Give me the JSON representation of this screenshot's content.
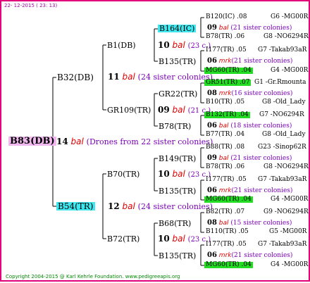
{
  "header": {
    "date": "22- 12-2015 ( 23: 13)"
  },
  "footer": {
    "copyright": "Copyright 2004-2015 @ Karl Kehrle Foundation.",
    "site": "www.pedigreeapis.org"
  },
  "root": {
    "id": "B83(DB)",
    "gen": "14",
    "mark": "bal",
    "note": "(Drones from 22 sister colonies)"
  },
  "g1": [
    {
      "id": "B32(DB)",
      "gen": "11",
      "mark": "bal",
      "note": "(24 sister colonies)"
    },
    {
      "id": "B54(TR)",
      "gen": "12",
      "mark": "bal",
      "note": "(24 sister colonies)"
    }
  ],
  "g2": [
    {
      "id": "B1(DB)",
      "gen": "10",
      "mark": "bal",
      "note": "(23 c.)"
    },
    {
      "id": "GR109(TR)",
      "gen": "09",
      "mark": "bal",
      "note": "(21 c.)"
    },
    {
      "id": "B70(TR)",
      "gen": "10",
      "mark": "bal",
      "note": "(23 c.)"
    },
    {
      "id": "B72(TR)",
      "gen": "10",
      "mark": "bal",
      "note": "(23 c.)"
    }
  ],
  "g3": [
    {
      "id": "B164(IC)",
      "gen": "09",
      "mark": "bal",
      "note": "(21 sister colonies)"
    },
    {
      "id": "B135(TR)",
      "gen": "06",
      "mark": "mrk",
      "note": "(21 sister colonies)"
    },
    {
      "id": "GR22(TR)",
      "gen": "08",
      "mark": "mrk",
      "note": "(16 sister colonies)"
    },
    {
      "id": "B78(TR)",
      "gen": "06",
      "mark": "bal",
      "note": "(18 sister colonies)"
    },
    {
      "id": "B149(TR)",
      "gen": "09",
      "mark": "bal",
      "note": "(21 sister colonies)"
    },
    {
      "id": "B135(TR)",
      "gen": "06",
      "mark": "mrk",
      "note": "(21 sister colonies)"
    },
    {
      "id": "B68(TR)",
      "gen": "08",
      "mark": "bal",
      "note": "(15 sister colonies)"
    },
    {
      "id": "B135(TR)",
      "gen": "06",
      "mark": "mrk",
      "note": "(21 sister colonies)"
    }
  ],
  "g4": [
    {
      "id": "B120(IC)",
      "val": ".08",
      "src": "G6 -MG00R"
    },
    {
      "id": "B78(TR)",
      "val": ".06",
      "src": "G8 -NO6294R"
    },
    {
      "id": "I177(TR)",
      "val": ".05",
      "src": "G7 -Takab93aR"
    },
    {
      "id": "MG60(TR)",
      "val": ".04",
      "src": "G4 -MG00R"
    },
    {
      "id": "GR51(TR)",
      "val": ".07",
      "src": "G1 -Gr.Rmounta"
    },
    {
      "id": "B10(TR)",
      "val": ".05",
      "src": "G8 -Old_Lady"
    },
    {
      "id": "B132(TR)",
      "val": ".04",
      "src": "G7 -NO6294R"
    },
    {
      "id": "B77(TR)",
      "val": ".04",
      "src": "G8 -Old_Lady"
    },
    {
      "id": "B88(TR)",
      "val": ".08",
      "src": "G23 -Sinop62R"
    },
    {
      "id": "B78(TR)",
      "val": ".06",
      "src": "G8 -NO6294R"
    },
    {
      "id": "I177(TR)",
      "val": ".05",
      "src": "G7 -Takab93aR"
    },
    {
      "id": "MG60(TR)",
      "val": ".04",
      "src": "G4 -MG00R"
    },
    {
      "id": "B82(TR)",
      "val": ".07",
      "src": "G9 -NO6294R"
    },
    {
      "id": "B110(TR)",
      "val": ".05",
      "src": "G5 -MG00R"
    },
    {
      "id": "I177(TR)",
      "val": ".05",
      "src": "G7 -Takab93aR"
    },
    {
      "id": "MG60(TR)",
      "val": ".04",
      "src": "G4 -MG00R"
    }
  ],
  "colors": {
    "frame": "#e0007a",
    "highlight_cyan": "#3fe8ef",
    "highlight_green": "#22dd22",
    "highlight_pink": "#f0b8ef",
    "mark": "#e00000",
    "note": "#7a00b8",
    "source": "#0000cc"
  }
}
